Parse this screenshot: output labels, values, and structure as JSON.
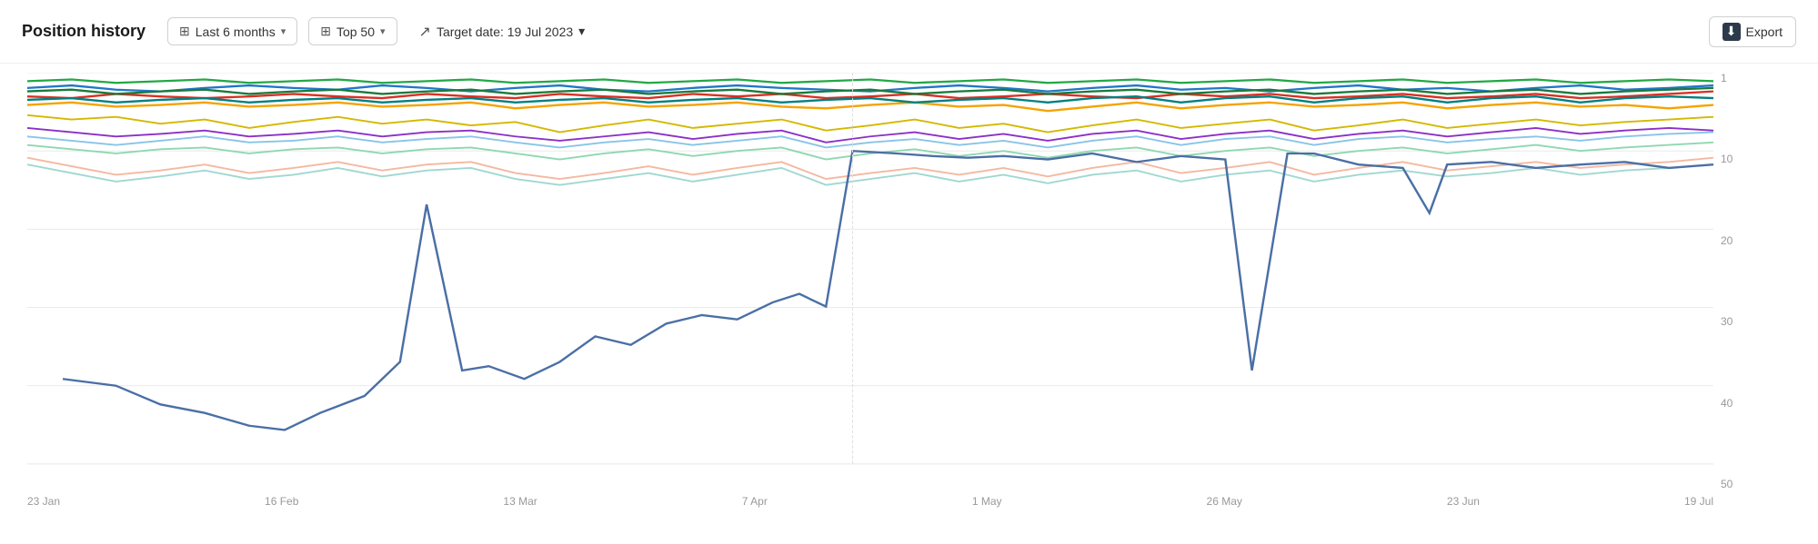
{
  "toolbar": {
    "title": "Position history",
    "last6months_label": "Last 6 months",
    "top50_label": "Top 50",
    "target_date_label": "Target date: 19 Jul 2023",
    "export_label": "Export",
    "calendar_icon": "▦",
    "table_icon": "▤",
    "trend_icon": "∿",
    "export_icon": "⬇",
    "chevron": "▾"
  },
  "chart": {
    "x_labels": [
      "23 Jan",
      "16 Feb",
      "13 Mar",
      "7 Apr",
      "1 May",
      "26 May",
      "23 Jun",
      "19 Jul"
    ],
    "y_labels": [
      "1",
      "10",
      "20",
      "30",
      "40",
      "50"
    ],
    "grid_lines": [
      0,
      1,
      10,
      20,
      30,
      40,
      50
    ]
  }
}
